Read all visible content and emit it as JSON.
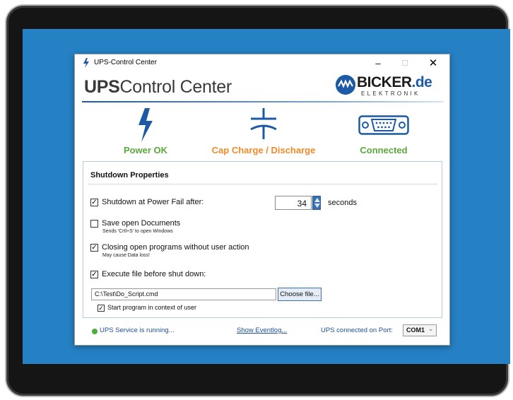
{
  "window": {
    "title": "UPS-Control Center",
    "minimize_glyph": "–",
    "maximize_glyph": "☐",
    "close_glyph": "✕"
  },
  "header": {
    "app_title_bold": "UPS",
    "app_title_rest": "Control Center",
    "logo_name": "BICKER",
    "logo_tld": ".de",
    "logo_sub": "ELEKTRONIK"
  },
  "status": [
    {
      "label": "Power OK",
      "icon": "lightning-icon",
      "color": "#5aa83c"
    },
    {
      "label": "Cap Charge / Discharge",
      "icon": "capacitor-icon",
      "color": "#f08a2a"
    },
    {
      "label": "Connected",
      "icon": "serial-port-icon",
      "color": "#5aa83c"
    }
  ],
  "shutdown": {
    "title": "Shutdown Properties",
    "power_fail": {
      "checked": true,
      "label": "Shutdown at Power Fail after:",
      "value": "34",
      "unit": "seconds"
    },
    "save_docs": {
      "checked": false,
      "label": "Save open Documents",
      "sub": "Sends 'Crtl+S' to open Windows"
    },
    "close_programs": {
      "checked": true,
      "label": "Closing open programs without user action",
      "sub": "May cause Data loss!"
    },
    "execute_file": {
      "checked": true,
      "label": "Execute file before shut down:",
      "path": "C:\\Test\\Do_Script.cmd",
      "choose_label": "Choose file..."
    },
    "user_context": {
      "checked": true,
      "label": "Start program in context of user"
    }
  },
  "footer": {
    "service_status": "UPS Service is running...",
    "eventlog_link": "Show Eventlog...",
    "port_label": "UPS connected on Port:",
    "port_value": "COM1"
  },
  "colors": {
    "accent": "#1c5aa5",
    "ok_green": "#5aa83c",
    "warn_orange": "#f08a2a",
    "desktop_blue": "#2581c4",
    "check_mark": "✓"
  }
}
